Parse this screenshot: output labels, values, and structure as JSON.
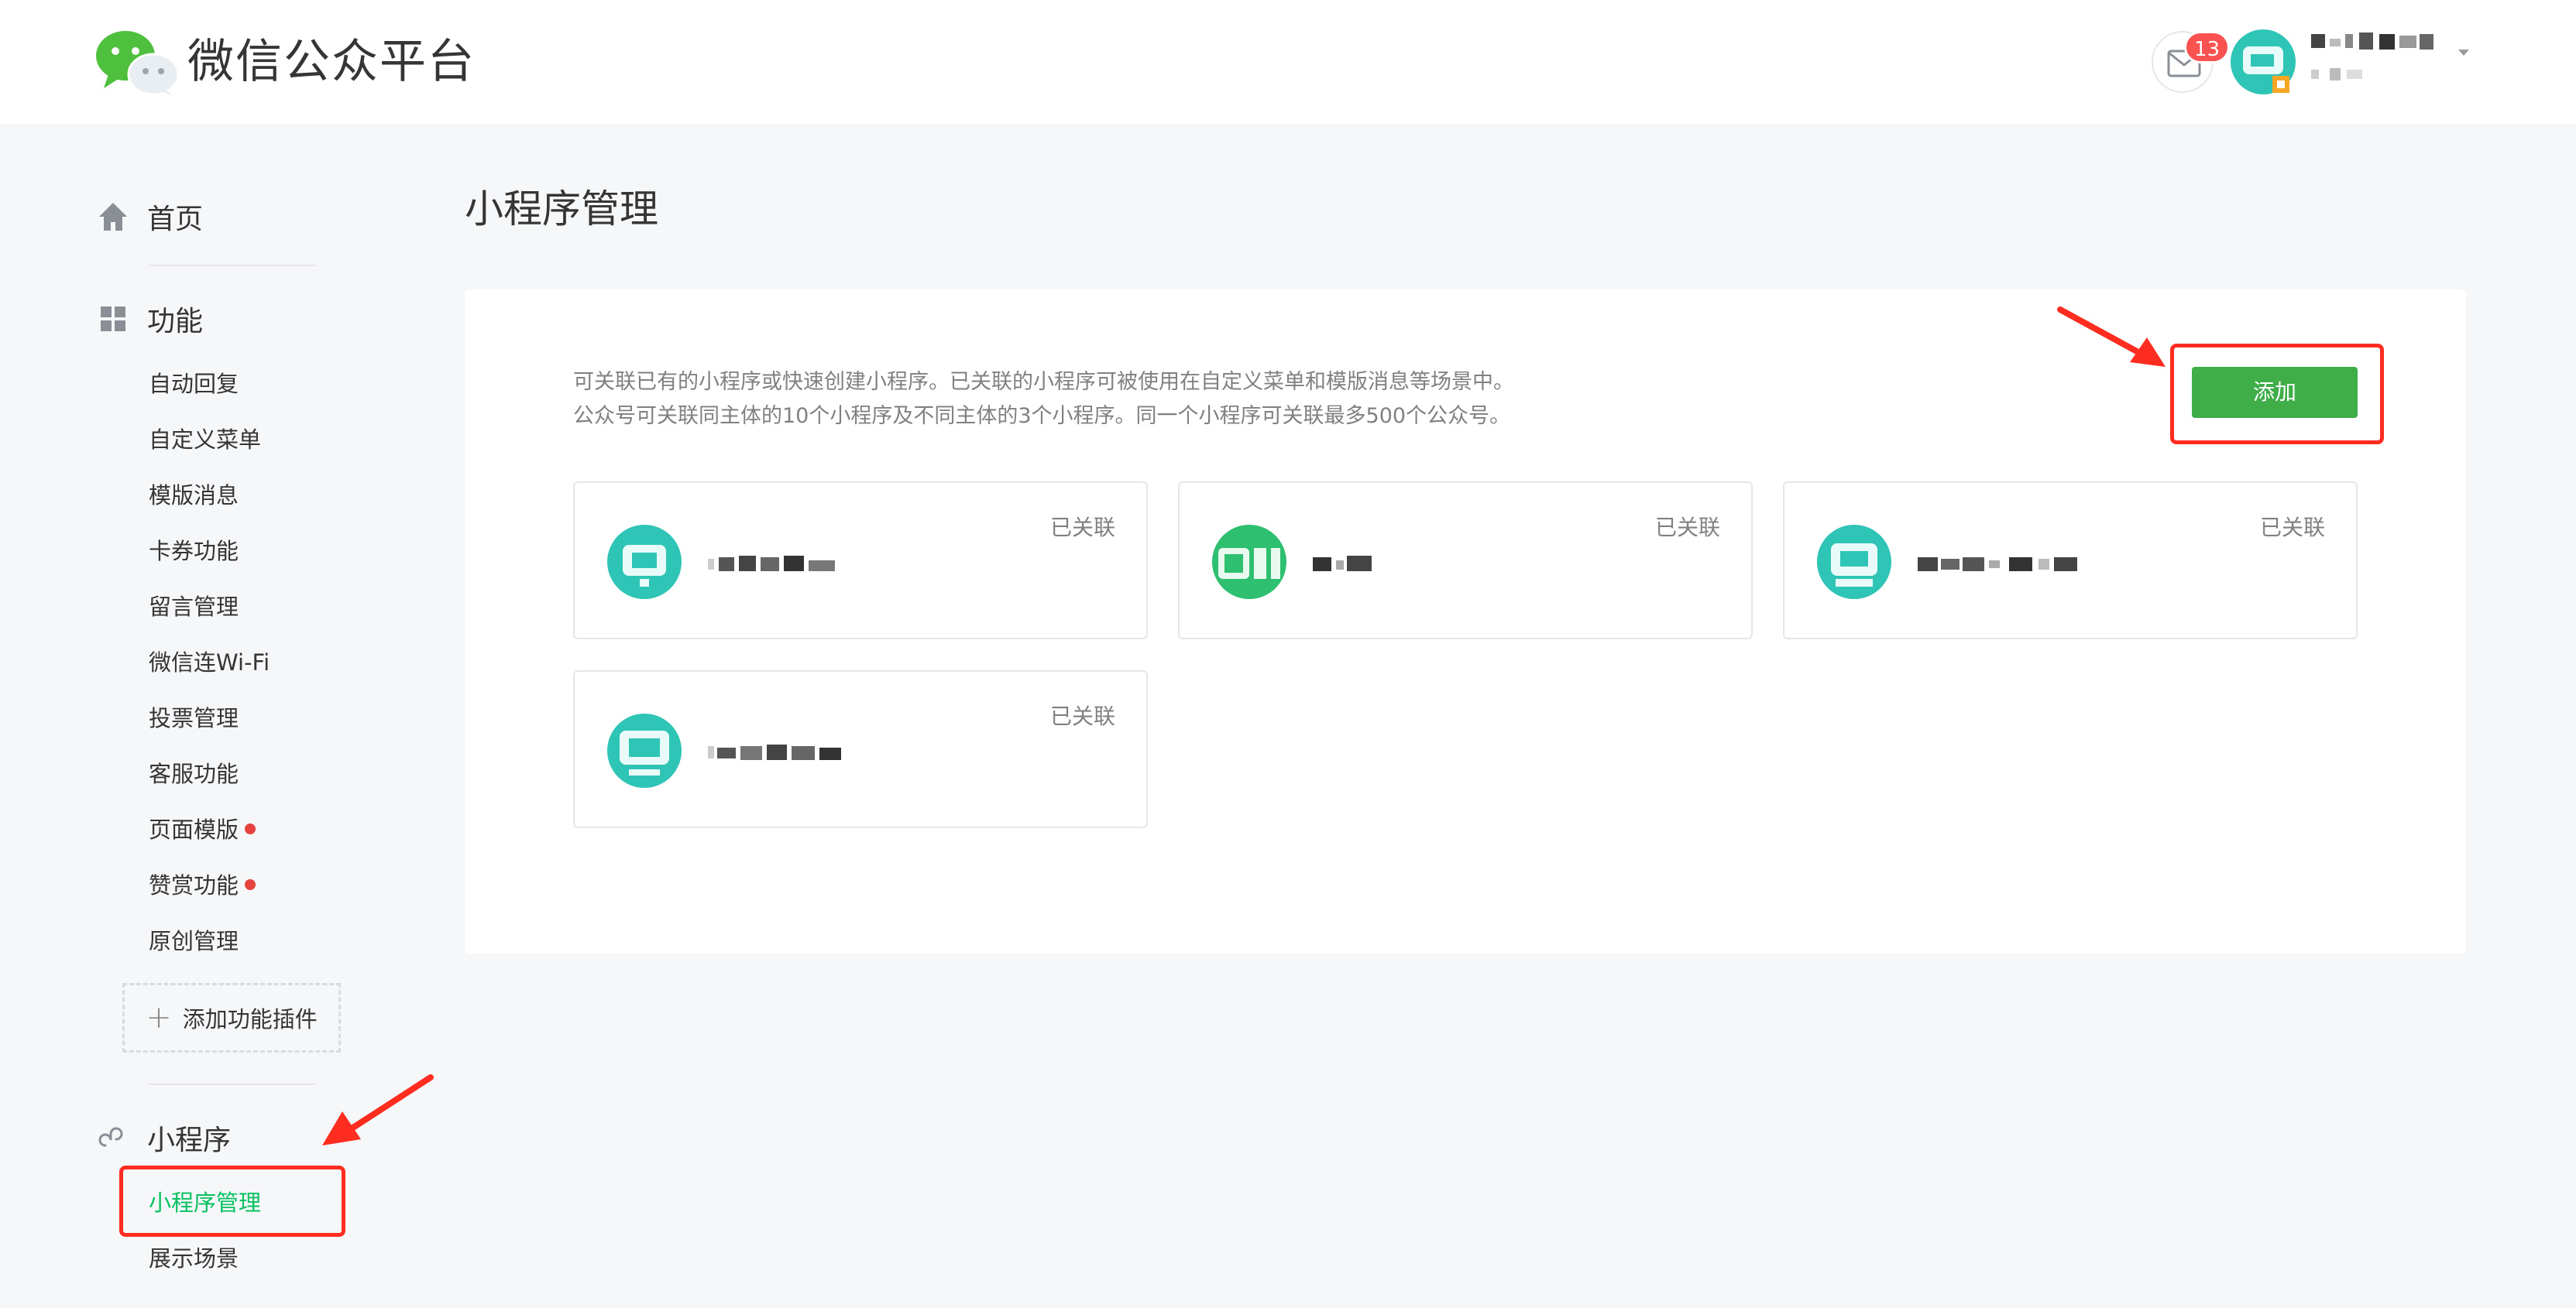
{
  "header": {
    "brand": "微信公众平台",
    "notification_count": "13"
  },
  "sidebar": {
    "home_label": "首页",
    "features_label": "功能",
    "feature_items": [
      {
        "label": "自动回复",
        "dot": false
      },
      {
        "label": "自定义菜单",
        "dot": false
      },
      {
        "label": "模版消息",
        "dot": false
      },
      {
        "label": "卡券功能",
        "dot": false
      },
      {
        "label": "留言管理",
        "dot": false
      },
      {
        "label": "微信连Wi-Fi",
        "dot": false
      },
      {
        "label": "投票管理",
        "dot": false
      },
      {
        "label": "客服功能",
        "dot": false
      },
      {
        "label": "页面模版",
        "dot": true
      },
      {
        "label": "赞赏功能",
        "dot": true
      },
      {
        "label": "原创管理",
        "dot": false
      }
    ],
    "add_plugin_label": "添加功能插件",
    "miniprogram_label": "小程序",
    "miniprogram_items": [
      {
        "label": "小程序管理",
        "active": true
      },
      {
        "label": "展示场景",
        "active": false
      }
    ]
  },
  "main": {
    "title": "小程序管理",
    "description_line1": "可关联已有的小程序或快速创建小程序。已关联的小程序可被使用在自定义菜单和模版消息等场景中。",
    "description_line2": "公众号可关联同主体的10个小程序及不同主体的3个小程序。同一个小程序可关联最多500个公众号。",
    "add_button_label": "添加",
    "cards": [
      {
        "status": "已关联"
      },
      {
        "status": "已关联"
      },
      {
        "status": "已关联"
      },
      {
        "status": "已关联"
      }
    ]
  },
  "colors": {
    "brand_green": "#07c160",
    "button_green": "#3fae49",
    "annotation_red": "#ff2d1f",
    "badge_red": "#fa5151"
  }
}
